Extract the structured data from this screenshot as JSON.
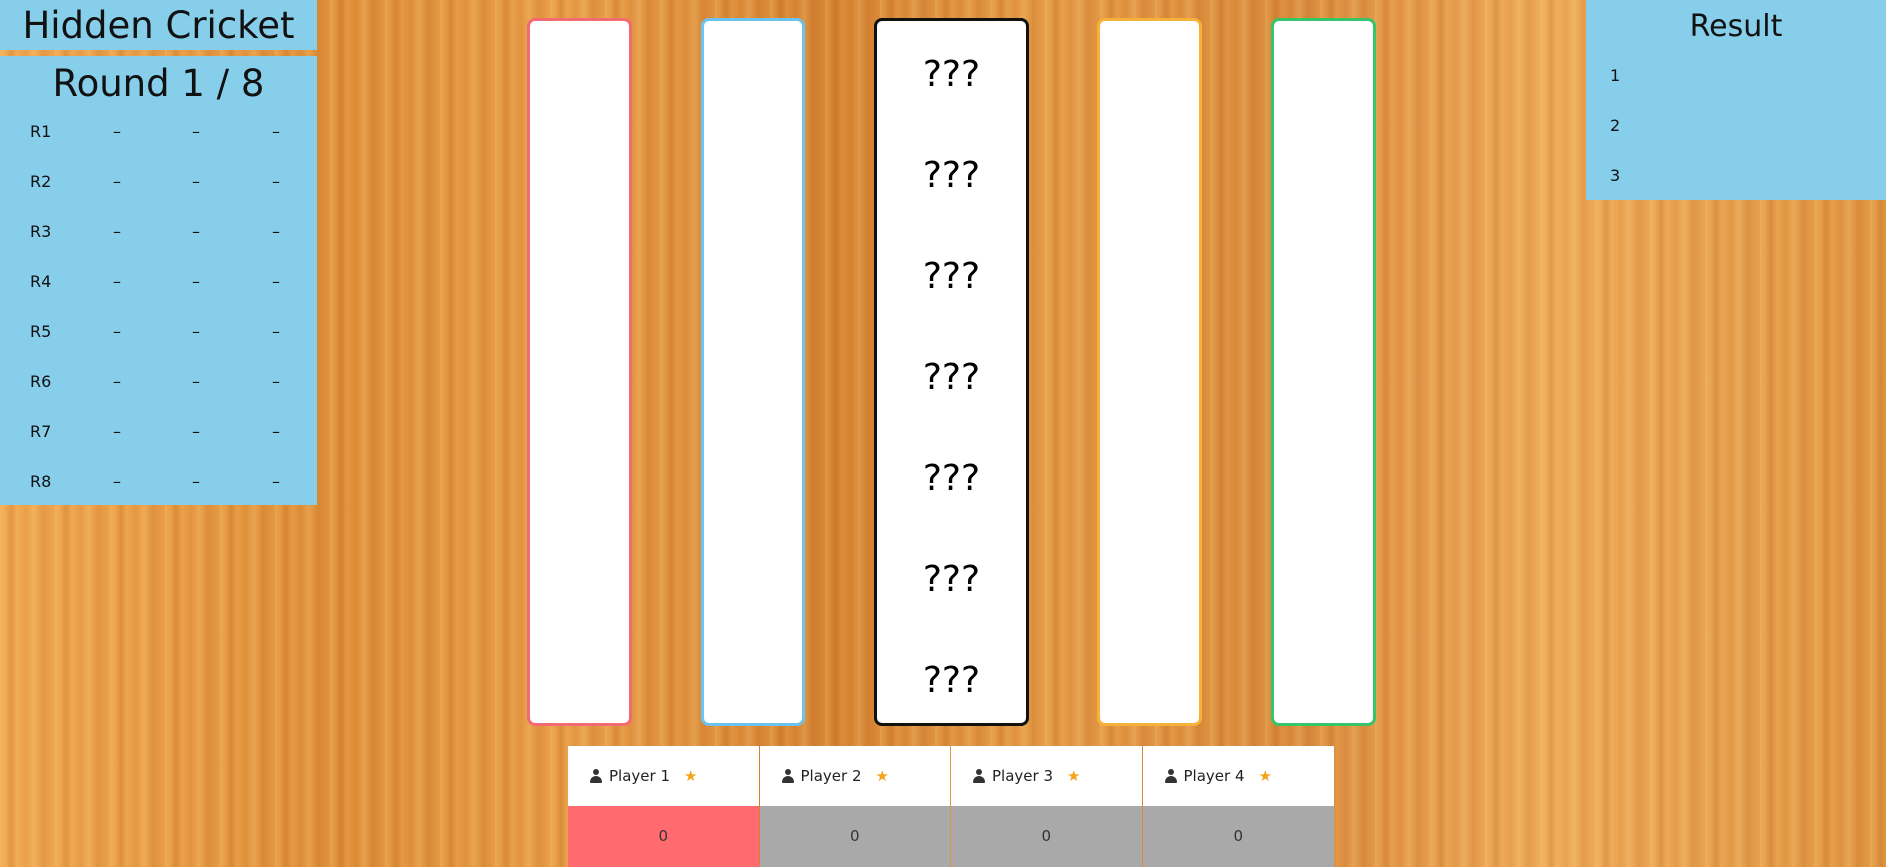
{
  "title": "Hidden Cricket",
  "round_label": "Round 1 / 8",
  "rounds": [
    {
      "label": "R1",
      "v1": "–",
      "v2": "–",
      "v3": "–"
    },
    {
      "label": "R2",
      "v1": "–",
      "v2": "–",
      "v3": "–"
    },
    {
      "label": "R3",
      "v1": "–",
      "v2": "–",
      "v3": "–"
    },
    {
      "label": "R4",
      "v1": "–",
      "v2": "–",
      "v3": "–"
    },
    {
      "label": "R5",
      "v1": "–",
      "v2": "–",
      "v3": "–"
    },
    {
      "label": "R6",
      "v1": "–",
      "v2": "–",
      "v3": "–"
    },
    {
      "label": "R7",
      "v1": "–",
      "v2": "–",
      "v3": "–"
    },
    {
      "label": "R8",
      "v1": "–",
      "v2": "–",
      "v3": "–"
    }
  ],
  "result": {
    "title": "Result",
    "rows": [
      "1",
      "2",
      "3"
    ]
  },
  "hidden_targets": [
    "???",
    "???",
    "???",
    "???",
    "???",
    "???",
    "???"
  ],
  "columns": {
    "player1_color": "#f26b74",
    "player2_color": "#6cc3ef",
    "target_color": "#111111",
    "player3_color": "#f8b23a",
    "player4_color": "#37c46a"
  },
  "players": [
    {
      "name": "Player 1",
      "icon": "person-icon",
      "badge_icon": "star-icon",
      "score": "0",
      "score_bg": "#ff6b6f",
      "active": true
    },
    {
      "name": "Player 2",
      "icon": "person-icon",
      "badge_icon": "star-icon",
      "score": "0",
      "score_bg": "#a9a9a9",
      "active": false
    },
    {
      "name": "Player 3",
      "icon": "person-icon",
      "badge_icon": "star-icon",
      "score": "0",
      "score_bg": "#a9a9a9",
      "active": false
    },
    {
      "name": "Player 4",
      "icon": "person-icon",
      "badge_icon": "star-icon",
      "score": "0",
      "score_bg": "#a9a9a9",
      "active": false
    }
  ]
}
